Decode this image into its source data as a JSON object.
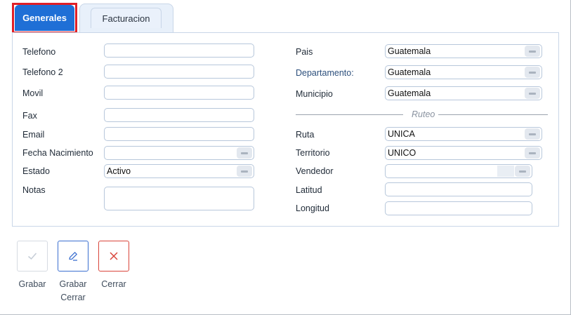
{
  "tabs": {
    "generales": "Generales",
    "facturacion": "Facturacion"
  },
  "left": {
    "telefono": {
      "label": "Telefono",
      "value": ""
    },
    "telefono2": {
      "label": "Telefono 2",
      "value": ""
    },
    "movil": {
      "label": "Movil",
      "value": ""
    },
    "fax": {
      "label": "Fax",
      "value": ""
    },
    "email": {
      "label": "Email",
      "value": ""
    },
    "fecha_nacimiento": {
      "label": "Fecha Nacimiento",
      "value": ""
    },
    "estado": {
      "label": "Estado",
      "value": "Activo"
    },
    "notas": {
      "label": "Notas",
      "value": ""
    }
  },
  "right": {
    "pais": {
      "label": "Pais",
      "value": "Guatemala"
    },
    "departamento": {
      "label": "Departamento:",
      "value": "Guatemala"
    },
    "municipio": {
      "label": "Municipio",
      "value": "Guatemala"
    },
    "ruteo": "Ruteo",
    "ruta": {
      "label": "Ruta",
      "value": "UNICA"
    },
    "territorio": {
      "label": "Territorio",
      "value": "UNICO"
    },
    "vendedor": {
      "label": "Vendedor",
      "value": ""
    },
    "latitud": {
      "label": "Latitud",
      "value": ""
    },
    "longitud": {
      "label": "Longitud",
      "value": ""
    }
  },
  "actions": {
    "grabar": "Grabar",
    "grabar_cerrar_line1": "Grabar",
    "grabar_cerrar_line2": "Cerrar",
    "cerrar": "Cerrar"
  },
  "colors": {
    "active_tab": "#1f6fd6",
    "highlight_outline": "#e01f26",
    "grabar_cerrar_border": "#3b6fd0",
    "cerrar_icon": "#d9453b"
  },
  "icons": {
    "grabar": "check-icon",
    "grabar_cerrar": "pencil-icon",
    "cerrar": "close-icon"
  }
}
